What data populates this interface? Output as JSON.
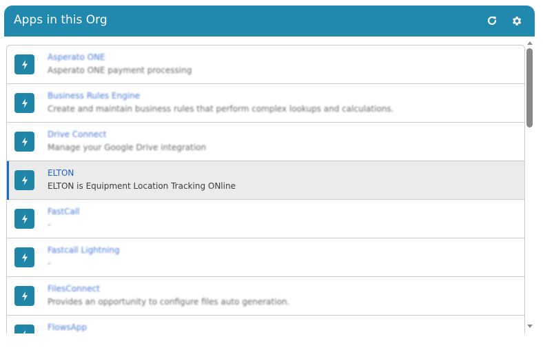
{
  "header": {
    "title": "Apps in this Org",
    "refresh_icon": "refresh-icon",
    "settings_icon": "gear-icon"
  },
  "apps": [
    {
      "name": "Asperato ONE",
      "description": "Asperato ONE payment processing",
      "icon": "lightning-bolt-icon"
    },
    {
      "name": "Business Rules Engine",
      "description": "Create and maintain business rules that perform complex lookups and calculations.",
      "icon": "lightning-bolt-icon"
    },
    {
      "name": "Drive Connect",
      "description": "Manage your Google Drive integration",
      "icon": "lightning-bolt-icon"
    },
    {
      "name": "ELTON",
      "description": "ELTON is Equipment Location Tracking ONline",
      "icon": "lightning-bolt-icon"
    },
    {
      "name": "FastCall",
      "description": "-",
      "icon": "lightning-bolt-icon"
    },
    {
      "name": "Fastcall Lightning",
      "description": "-",
      "icon": "lightning-bolt-icon"
    },
    {
      "name": "FilesConnect",
      "description": "Provides an opportunity to configure files auto generation.",
      "icon": "lightning-bolt-icon"
    },
    {
      "name": "FlowsApp",
      "description": "",
      "icon": "lightning-bolt-icon"
    }
  ],
  "colors": {
    "header_bg": "#2089ad",
    "icon_bg": "#1f86a8",
    "link": "#1b5fcc",
    "selected_bg": "#ebebeb",
    "selected_accent": "#1b6cc4"
  }
}
